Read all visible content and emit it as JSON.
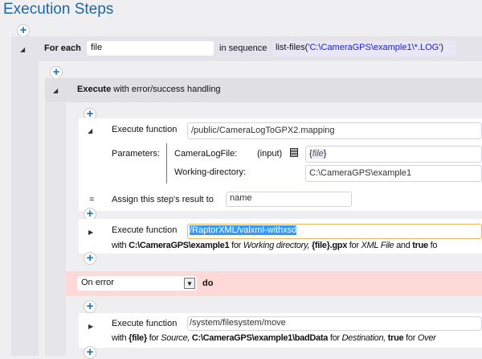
{
  "title": "Execution Steps",
  "foreach": {
    "label": "For each",
    "variable": "file",
    "in_sequence": "in sequence",
    "expr_fn": "list-files(",
    "expr_arg": "'C:\\CameraGPS\\example1\\*.LOG'",
    "expr_close": ")"
  },
  "execute": {
    "bold": "Execute",
    "rest": "with error/success handling"
  },
  "step1": {
    "label": "Execute function",
    "function": "/public/CameraLogToGPX2.mapping",
    "parameters_label": "Parameters:",
    "params": [
      {
        "name": "CameraLogFile:",
        "kind": "(input)",
        "value_open": "{",
        "value_var": "file",
        "value_close": "}"
      },
      {
        "name": "Working-directory:",
        "value": "C:\\CameraGPS\\example1"
      }
    ],
    "assign_symbol": "=",
    "assign_label": "Assign this step's result to",
    "assign_value": "name"
  },
  "step2": {
    "label": "Execute function",
    "function": "/RaptorXML/valxml-withxsd",
    "with": "with",
    "v1": "C:\\CameraGPS\\example1",
    "f1": "for",
    "p1": "Working directory,",
    "v2": "{file}.gpx",
    "f2": "for",
    "p2": "XML File",
    "and": "and",
    "v3": "true",
    "f3": "fo"
  },
  "on_error": {
    "select": "On error",
    "do": "do"
  },
  "step3": {
    "label": "Execute function",
    "function": "/system/filesystem/move",
    "with": "with",
    "v1": "{file}",
    "f1": "for",
    "p1": "Source,",
    "v2": "C:\\CameraGPS\\example1\\badData",
    "f2": "for",
    "p2": "Destination,",
    "v3": "true",
    "f3": "for",
    "p3": "Over"
  },
  "colors": {
    "accent": "#1b67a6",
    "error_bg": "#ffd8d8",
    "selection": "#3399ff"
  }
}
